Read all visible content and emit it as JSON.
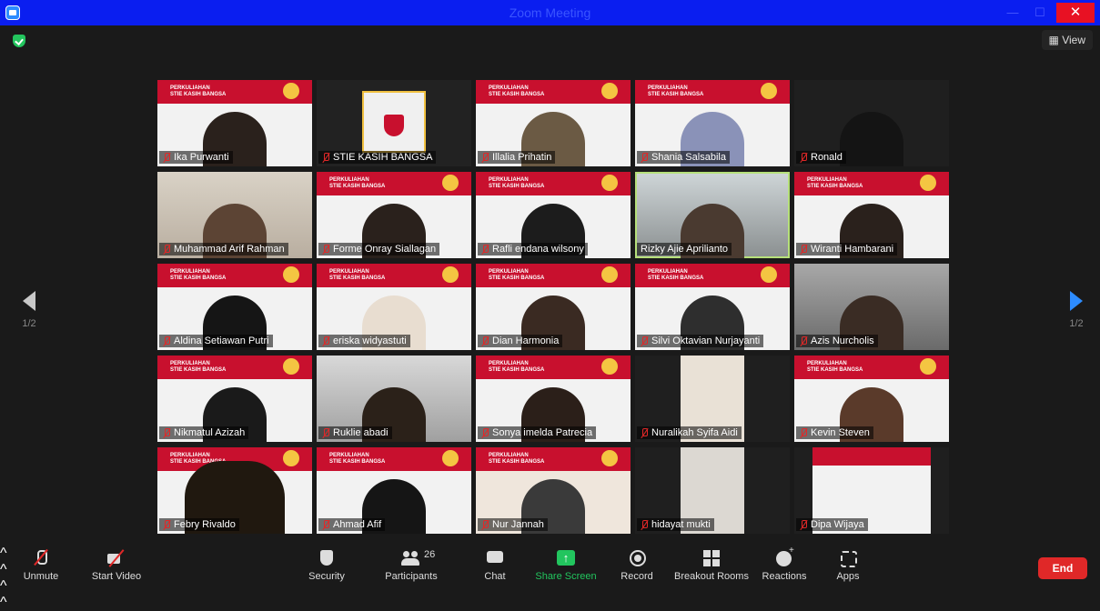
{
  "window": {
    "title": "Zoom Meeting",
    "minimize": "—",
    "maximize": "☐",
    "close": "✕"
  },
  "topbar": {
    "view_label": "View"
  },
  "banner": {
    "line1": "PERKULIAHAN",
    "line2": "STIE KASIH BANGSA"
  },
  "participants": [
    {
      "name": "Ika Purwanti",
      "muted": true
    },
    {
      "name": "STIE KASIH BANGSA",
      "muted": true
    },
    {
      "name": "Illalia Prihatin",
      "muted": true
    },
    {
      "name": "Shania Salsabila",
      "muted": true
    },
    {
      "name": "Ronald",
      "muted": true
    },
    {
      "name": "Muhammad Arif Rahman",
      "muted": true
    },
    {
      "name": "Forme Onray Siallagan",
      "muted": true
    },
    {
      "name": "Rafli endana wilsony",
      "muted": true
    },
    {
      "name": "Rizky Ajie Aprilianto",
      "muted": false
    },
    {
      "name": "Wiranti Hambarani",
      "muted": true
    },
    {
      "name": "Aldina Setiawan Putri",
      "muted": true
    },
    {
      "name": "eriska widyastuti",
      "muted": true
    },
    {
      "name": "Dian Harmonia",
      "muted": true
    },
    {
      "name": "Silvi Oktavian Nurjayanti",
      "muted": true
    },
    {
      "name": "Azis Nurcholis",
      "muted": true
    },
    {
      "name": "Nikmatul Azizah",
      "muted": true
    },
    {
      "name": "Ruklie abadi",
      "muted": true
    },
    {
      "name": "Sonya imelda Patrecia",
      "muted": true
    },
    {
      "name": "Nuralikah Syifa Aidi",
      "muted": true
    },
    {
      "name": "Kevin Steven",
      "muted": true
    },
    {
      "name": "Febry Rivaldo",
      "muted": true
    },
    {
      "name": "Ahmad Afif",
      "muted": true
    },
    {
      "name": "Nur Jannah",
      "muted": true
    },
    {
      "name": "hidayat mukti",
      "muted": true
    },
    {
      "name": "Dipa Wijaya",
      "muted": true
    }
  ],
  "pager": {
    "left": "1/2",
    "right": "1/2"
  },
  "toolbar": {
    "unmute": "Unmute",
    "start_video": "Start Video",
    "security": "Security",
    "participants": "Participants",
    "participant_count": "26",
    "chat": "Chat",
    "share_screen": "Share Screen",
    "record": "Record",
    "breakout_rooms": "Breakout Rooms",
    "reactions": "Reactions",
    "apps": "Apps",
    "end": "End"
  },
  "colors": {
    "titlebar": "#0a1ef0",
    "banner_red": "#c8102e",
    "share_green": "#22c55e",
    "end_red": "#e02828",
    "active_outline": "#b6e07a"
  }
}
